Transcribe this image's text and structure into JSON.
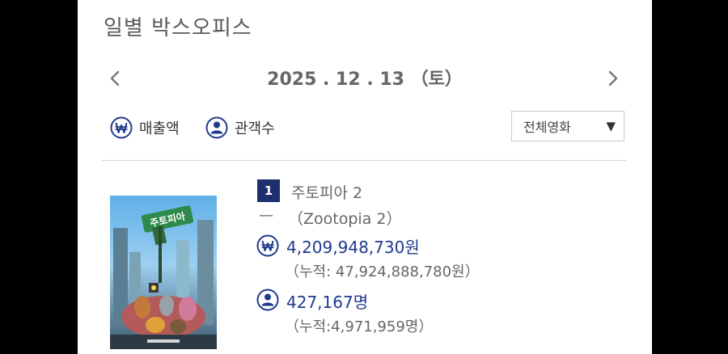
{
  "header": {
    "title": "일별 박스오피스"
  },
  "date_nav": {
    "date": "2025 . 12 . 13 （토）"
  },
  "toggles": {
    "sales_label": "매출액",
    "audience_label": "관객수"
  },
  "filter": {
    "selected": "전체영화"
  },
  "movies": [
    {
      "rank": "1",
      "title": "주토피아 2",
      "rank_change": "—",
      "original_title": "（Zootopia 2）",
      "sales": "4,209,948,730원",
      "sales_cumulative": "（누적: 47,924,888,780원）",
      "audience": "427,167명",
      "audience_cumulative": "（누적:4,971,959명）",
      "poster_text": "주토피아"
    }
  ],
  "colors": {
    "accent_blue": "#1f3a8c",
    "badge_navy": "#1e2f6e",
    "background": "#000000"
  },
  "icons": {
    "prev": "chevron-left-icon",
    "next": "chevron-right-icon",
    "sales": "won-icon",
    "audience": "person-icon",
    "dropdown": "caret-down-icon"
  }
}
